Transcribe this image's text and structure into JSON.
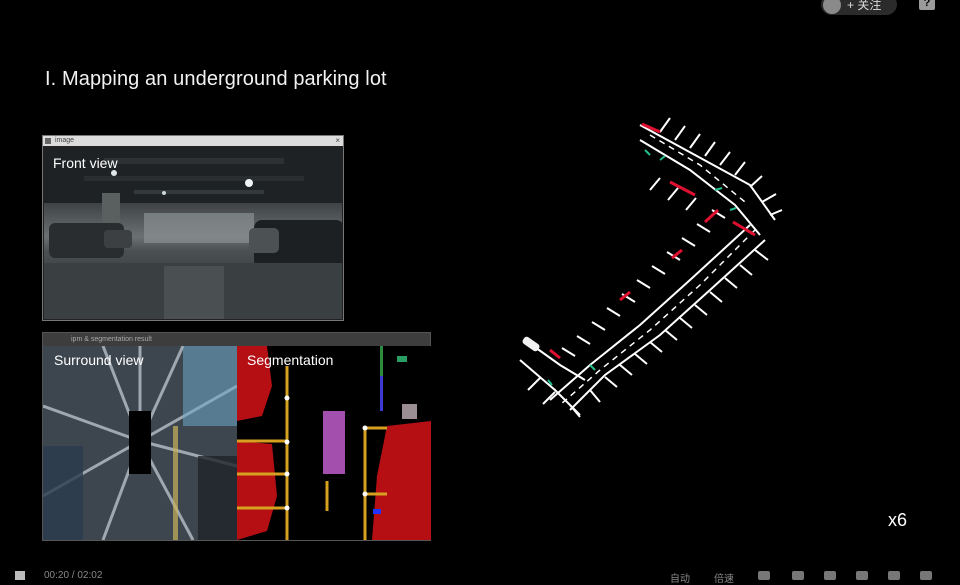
{
  "header": {
    "follow_label": "+ 关注",
    "help_label": "?"
  },
  "slide": {
    "title": "I. Mapping an underground parking lot"
  },
  "front_window": {
    "title_bar": "image",
    "label": "Front view"
  },
  "seg_window": {
    "title_bar": "ipm & segmentation result",
    "surround_label": "Surround view",
    "segmentation_label": "Segmentation"
  },
  "overlay": {
    "speed": "x6"
  },
  "player": {
    "time": "00:20 / 02:02",
    "auto_label": "自动",
    "speed_label": "倍速"
  }
}
